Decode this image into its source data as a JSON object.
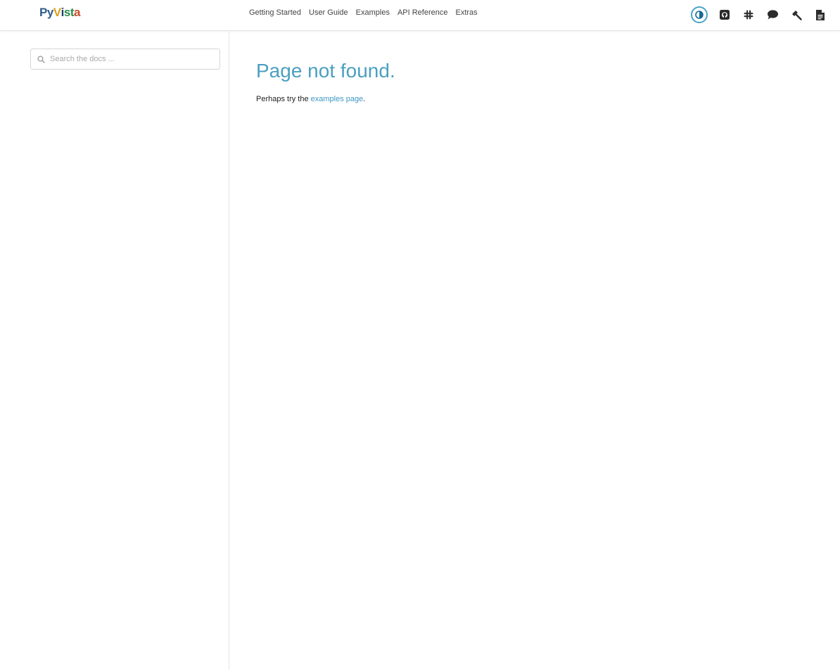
{
  "header": {
    "logo": {
      "part1": "Py",
      "part2": "V",
      "part3": "i",
      "part4": "st",
      "part5": "a"
    },
    "nav": [
      {
        "label": "Getting Started"
      },
      {
        "label": "User Guide"
      },
      {
        "label": "Examples"
      },
      {
        "label": "API Reference"
      },
      {
        "label": "Extras"
      }
    ],
    "icons": [
      "theme-toggle-icon",
      "github-icon",
      "slack-icon",
      "discussion-icon",
      "build-icon",
      "document-icon"
    ],
    "accent": "#4aa3c6"
  },
  "sidebar": {
    "search": {
      "placeholder": "Search the docs ...",
      "value": ""
    }
  },
  "main": {
    "title": "Page not found.",
    "text_before": "Perhaps try the ",
    "link_label": "examples page",
    "text_after": ".",
    "title_color": "#4b9fbf"
  }
}
